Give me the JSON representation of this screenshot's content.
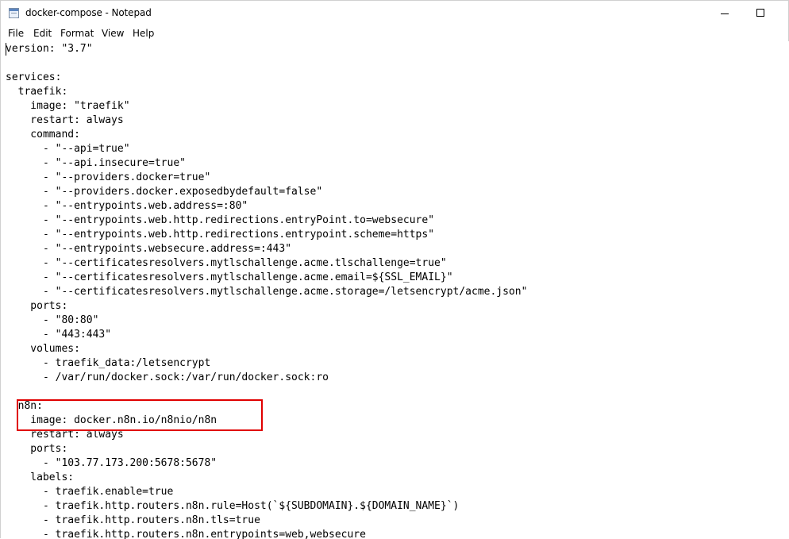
{
  "window": {
    "title": "docker-compose - Notepad"
  },
  "titlebar": {
    "app_icon": "notepad-icon",
    "minimize_icon": "minimize-icon",
    "maximize_icon": "maximize-icon"
  },
  "menu": {
    "items": [
      "File",
      "Edit",
      "Format",
      "View",
      "Help"
    ]
  },
  "editor": {
    "lines": [
      "version: \"3.7\"",
      "",
      "services:",
      "  traefik:",
      "    image: \"traefik\"",
      "    restart: always",
      "    command:",
      "      - \"--api=true\"",
      "      - \"--api.insecure=true\"",
      "      - \"--providers.docker=true\"",
      "      - \"--providers.docker.exposedbydefault=false\"",
      "      - \"--entrypoints.web.address=:80\"",
      "      - \"--entrypoints.web.http.redirections.entryPoint.to=websecure\"",
      "      - \"--entrypoints.web.http.redirections.entrypoint.scheme=https\"",
      "      - \"--entrypoints.websecure.address=:443\"",
      "      - \"--certificatesresolvers.mytlschallenge.acme.tlschallenge=true\"",
      "      - \"--certificatesresolvers.mytlschallenge.acme.email=${SSL_EMAIL}\"",
      "      - \"--certificatesresolvers.mytlschallenge.acme.storage=/letsencrypt/acme.json\"",
      "    ports:",
      "      - \"80:80\"",
      "      - \"443:443\"",
      "    volumes:",
      "      - traefik_data:/letsencrypt",
      "      - /var/run/docker.sock:/var/run/docker.sock:ro",
      "",
      "  n8n:",
      "    image: docker.n8n.io/n8nio/n8n",
      "    restart: always",
      "    ports:",
      "      - \"103.77.173.200:5678:5678\"",
      "    labels:",
      "      - traefik.enable=true",
      "      - traefik.http.routers.n8n.rule=Host(`${SUBDOMAIN}.${DOMAIN_NAME}`)",
      "      - traefik.http.routers.n8n.tls=true",
      "      - traefik.http.routers.n8n.entrypoints=web,websecure"
    ],
    "annotation_color": "#e00000"
  }
}
